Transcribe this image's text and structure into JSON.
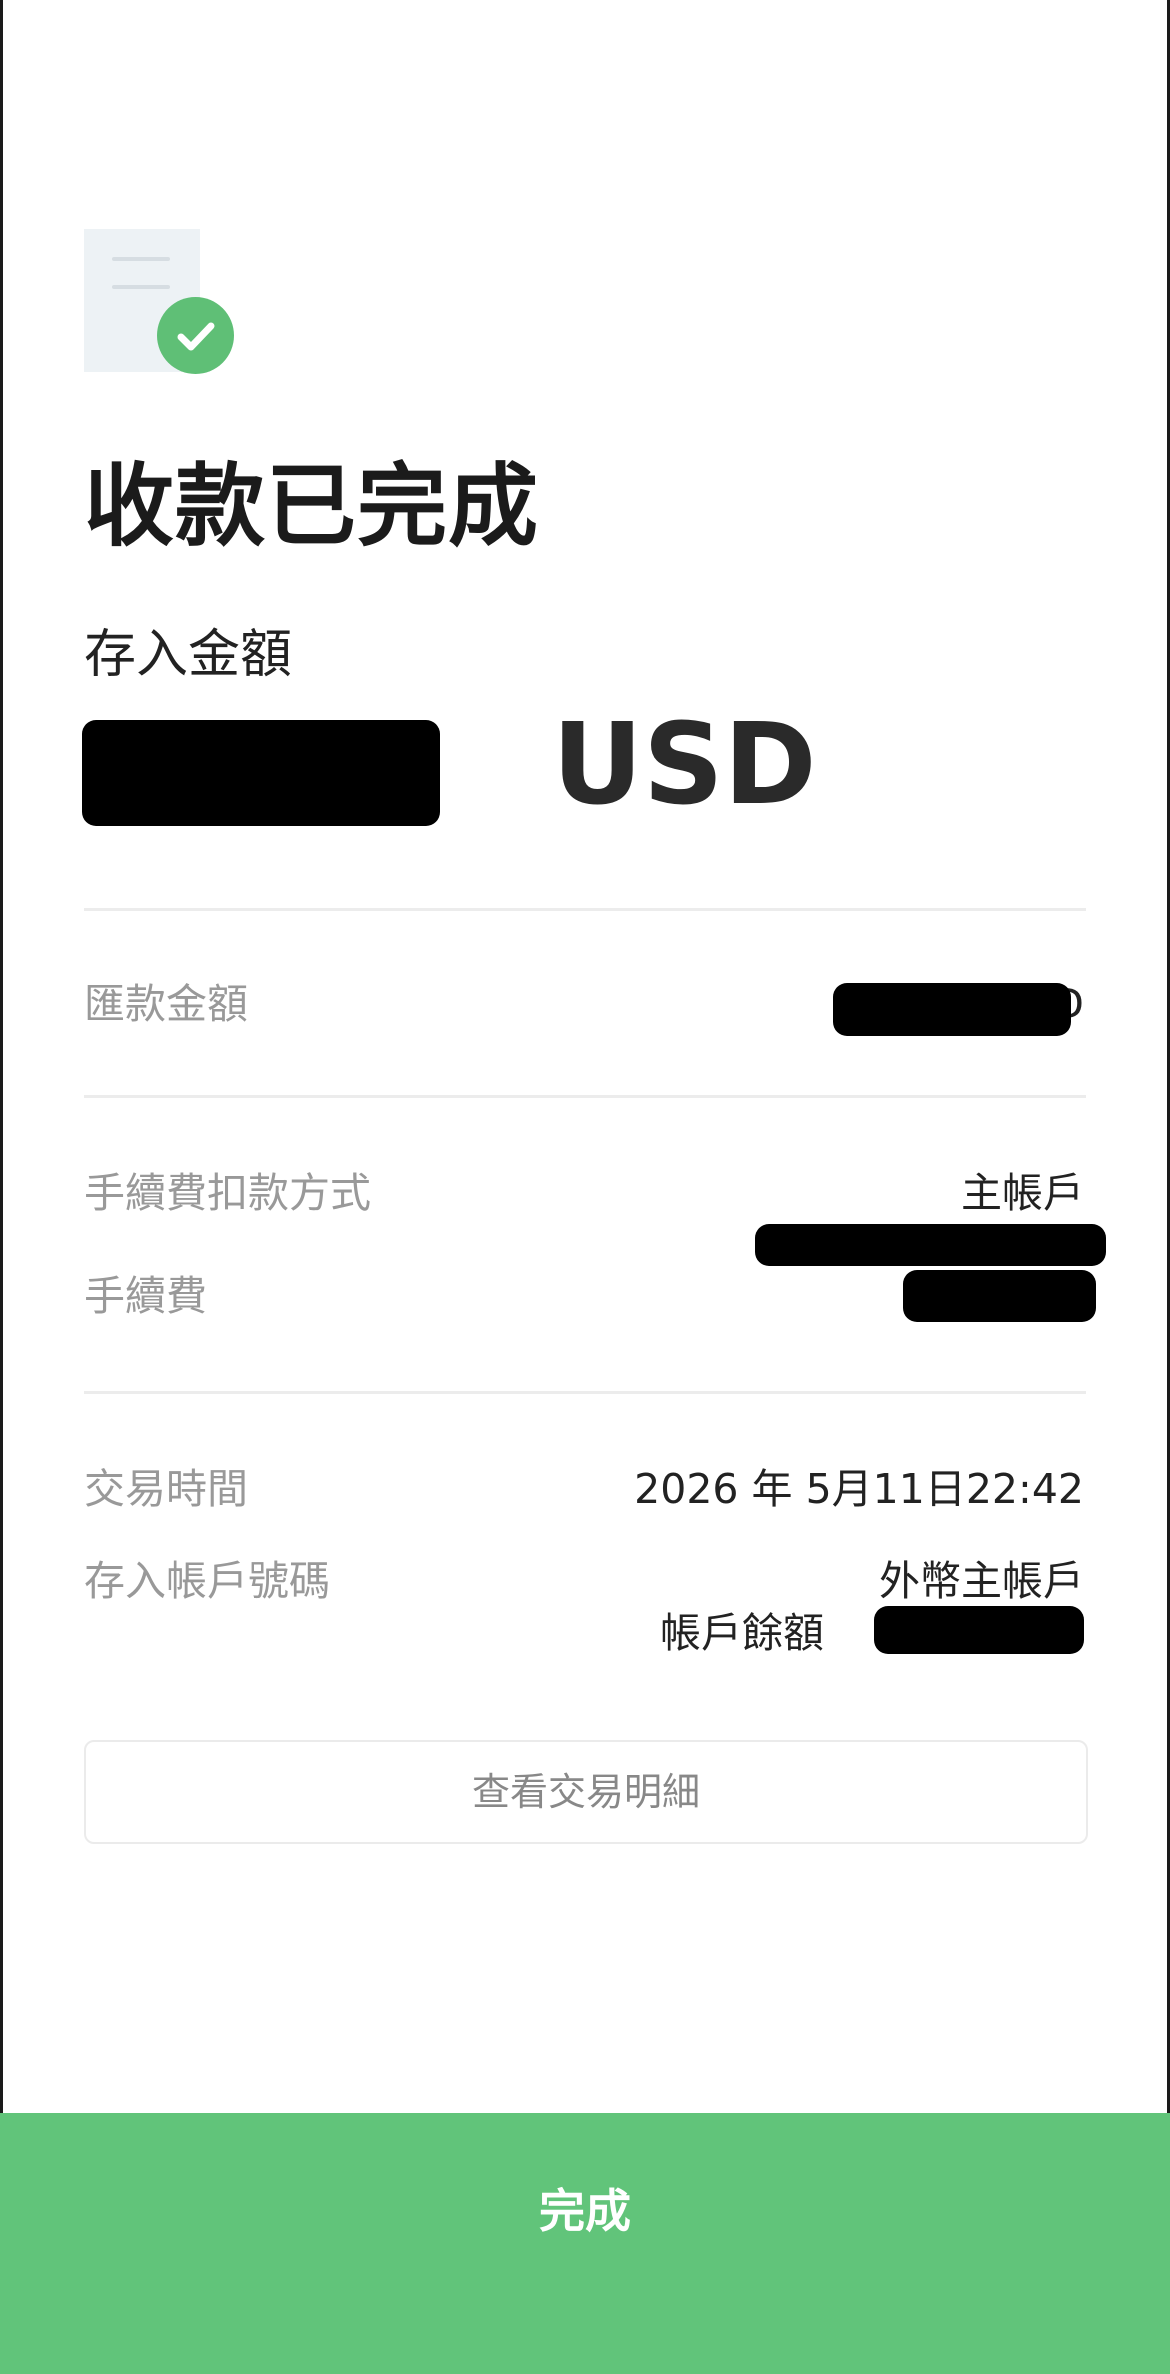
{
  "header": {
    "status_icon": "receipt-check-icon",
    "title": "收款已完成"
  },
  "deposit": {
    "label": "存入金額",
    "currency": "USD"
  },
  "remittance": {
    "label": "匯款金額",
    "value_tail": "D"
  },
  "fee": {
    "method_label": "手續費扣款方式",
    "method_value": "主帳戶",
    "label": "手續費"
  },
  "transaction": {
    "time_label": "交易時間",
    "time_value": "2026 年 5月11日22:42",
    "account_label": "存入帳戶號碼",
    "account_value": "外幣主帳戶",
    "balance_label": "帳戶餘額"
  },
  "actions": {
    "view_details": "查看交易明細",
    "done": "完成"
  },
  "colors": {
    "accent_green": "#61c47a",
    "check_green": "#5fbf76"
  }
}
